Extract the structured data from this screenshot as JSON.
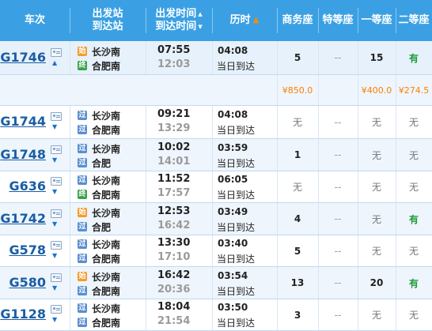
{
  "header": {
    "train_no": "车次",
    "station_line1": "出发站",
    "station_line2": "到达站",
    "time_line1": "出发时间",
    "time_line2": "到达时间",
    "duration": "历时",
    "business": "商务座",
    "premium": "特等座",
    "first": "一等座",
    "second": "二等座"
  },
  "sameday_label": "当日到达",
  "price_row": {
    "business": "¥850.0",
    "first": "¥400.0",
    "second": "¥274.5"
  },
  "trains": [
    {
      "no": "G1746",
      "from_tag": "始",
      "from": "长沙南",
      "to_tag": "终",
      "to": "合肥南",
      "dep": "07:55",
      "arr": "12:03",
      "dur": "04:08",
      "business": "5",
      "premium": "--",
      "first": "15",
      "second": "有"
    },
    {
      "no": "G1744",
      "from_tag": "过",
      "from": "长沙南",
      "to_tag": "过",
      "to": "合肥南",
      "dep": "09:21",
      "arr": "13:29",
      "dur": "04:08",
      "business": "无",
      "premium": "--",
      "first": "无",
      "second": "无"
    },
    {
      "no": "G1748",
      "from_tag": "过",
      "from": "长沙南",
      "to_tag": "过",
      "to": "合肥",
      "dep": "10:02",
      "arr": "14:01",
      "dur": "03:59",
      "business": "1",
      "premium": "--",
      "first": "无",
      "second": "无"
    },
    {
      "no": "G636",
      "from_tag": "过",
      "from": "长沙南",
      "to_tag": "终",
      "to": "合肥南",
      "dep": "11:52",
      "arr": "17:57",
      "dur": "06:05",
      "business": "无",
      "premium": "--",
      "first": "无",
      "second": "无"
    },
    {
      "no": "G1742",
      "from_tag": "始",
      "from": "长沙南",
      "to_tag": "过",
      "to": "合肥",
      "dep": "12:53",
      "arr": "16:42",
      "dur": "03:49",
      "business": "4",
      "premium": "--",
      "first": "无",
      "second": "有"
    },
    {
      "no": "G578",
      "from_tag": "过",
      "from": "长沙南",
      "to_tag": "过",
      "to": "合肥南",
      "dep": "13:30",
      "arr": "17:10",
      "dur": "03:40",
      "business": "5",
      "premium": "--",
      "first": "无",
      "second": "无"
    },
    {
      "no": "G580",
      "from_tag": "始",
      "from": "长沙南",
      "to_tag": "过",
      "to": "合肥南",
      "dep": "16:42",
      "arr": "20:36",
      "dur": "03:54",
      "business": "13",
      "premium": "--",
      "first": "20",
      "second": "有"
    },
    {
      "no": "G1128",
      "from_tag": "过",
      "from": "长沙南",
      "to_tag": "过",
      "to": "合肥南",
      "dep": "18:04",
      "arr": "21:54",
      "dur": "03:50",
      "business": "3",
      "premium": "--",
      "first": "无",
      "second": "无"
    }
  ],
  "colors": {
    "header_bg": "#3aa0e3",
    "price": "#ff7e00",
    "available": "#1f9a3a",
    "train_link": "#1a5da3"
  }
}
